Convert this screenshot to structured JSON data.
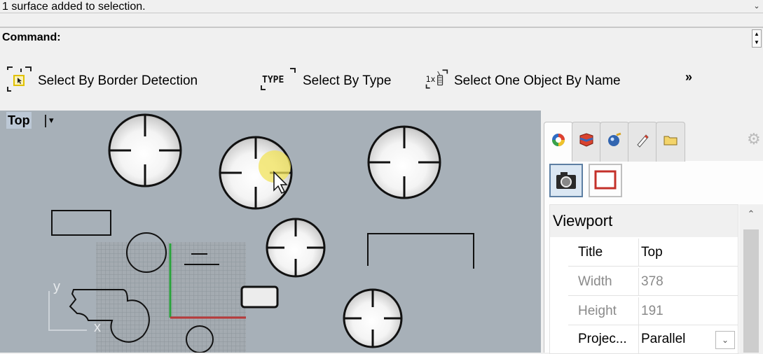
{
  "command_history": {
    "message": "1 surface added to selection."
  },
  "command_line": {
    "label": "Command:"
  },
  "toolbar": {
    "items": [
      {
        "label": "Select By Border Detection",
        "icon": "border-detection-icon"
      },
      {
        "label": "Select By Type",
        "icon": "type-icon",
        "icon_text": "TYPE"
      },
      {
        "label": "Select One Object By Name",
        "icon": "name-tag-icon",
        "icon_text": "1x"
      }
    ],
    "more": "»"
  },
  "viewport": {
    "title": "Top",
    "dropdown_glyph": "▾",
    "background": "#a7b0b8",
    "axis_labels": {
      "x": "x",
      "y": "y"
    }
  },
  "panel": {
    "tabs": [
      "display-color-icon",
      "layers-icon",
      "render-icon",
      "pencil-icon",
      "folder-icon",
      "gear-icon"
    ],
    "buttons": [
      "camera-icon",
      "frame-icon"
    ],
    "section_title": "Viewport",
    "properties": [
      {
        "label": "Title",
        "value": "Top",
        "enabled": true
      },
      {
        "label": "Width",
        "value": "378",
        "enabled": false
      },
      {
        "label": "Height",
        "value": "191",
        "enabled": false
      },
      {
        "label": "Projec...",
        "value": "Parallel",
        "enabled": true,
        "dropdown": true
      }
    ]
  }
}
